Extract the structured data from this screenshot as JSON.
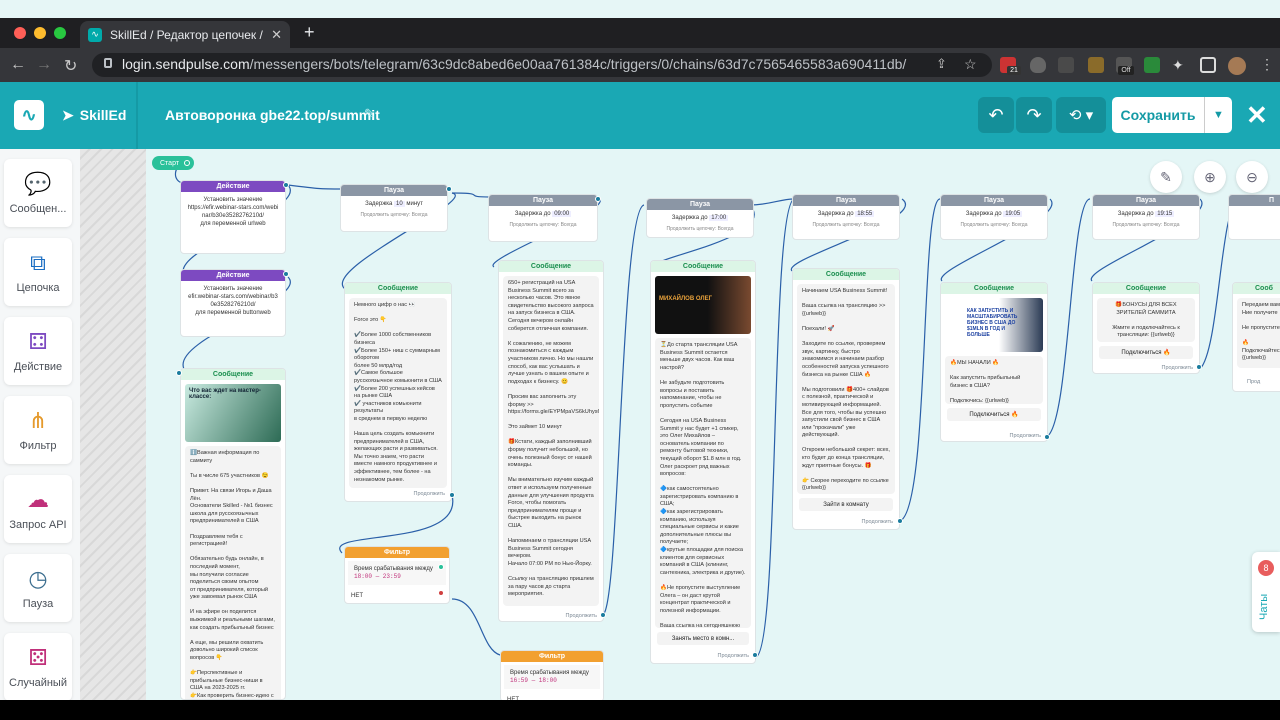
{
  "browser": {
    "tab_title": "SkillEd / Редактор цепочек / Ч",
    "url_host": "login.sendpulse.com",
    "url_path": "/messengers/bots/telegram/63c9dc8abed6e00aa761384c/triggers/0/chains/63d7c7565465583a690411db/",
    "ext_badge": "21",
    "ext_off": "Off"
  },
  "app": {
    "brand": "SkillEd",
    "funnel_title": "Автоворонка gbe22.top/summit",
    "save_label": "Сохранить"
  },
  "sidebar": {
    "items": [
      {
        "label": "Сообщен..."
      },
      {
        "label": "Цепочка"
      },
      {
        "label": "Действие"
      },
      {
        "label": "Фильтр"
      },
      {
        "label": "Запрос API"
      },
      {
        "label": "Пауза"
      },
      {
        "label": "Случайный"
      }
    ]
  },
  "canvas": {
    "start_label": "Старт",
    "action1": {
      "title": "Действие",
      "line1": "Установить значение",
      "line2": "https://efir.webinar-stars.com/webinar/b30e3528276210d/",
      "line3": "для переменной",
      "var": "urlweb"
    },
    "action2": {
      "title": "Действие",
      "line1": "Установить значение",
      "line2": "efir.webinar-stars.com/webinar/b30e3528276210d/",
      "line3": "для переменной",
      "var": "buttonweb"
    },
    "msg1": {
      "title": "Сообщение",
      "img_text": "Что вас ждет на мастер-классе:",
      "text": "ℹ️Важная информация по саммиту\n\nТы в числе 675 участников 😉\n\nПривет. На связи Игорь и Даша Лён.\nОснователи Skilled - №1 бизнес школа для русскоязычных предпринимателей в США\n\nПоздравляем тебя с регистрацией!\n\nОбязательно будь онлайн, в последний момент,\nмы получили согласие поделиться своим опытом\nот предпринимателя, который уже завоевал рынок США\n\nИ на эфире он поделится выжимкой и реальными шагами, как создать прибыльный бизнес\n\nА еще, мы решили охватить довольно широкий список вопросов 👇\n\n👉Перспективные и прибыльные бизнес-ниши в США на 2023-2025 гг.\n👉Как проверить бизнес-идею с минимальными вложениями?"
    },
    "pause1": {
      "title": "Пауза",
      "text": "Задержка",
      "value": "10",
      "unit": "минут",
      "sub": "Продолжить цепочку: Всегда"
    },
    "msg2": {
      "title": "Сообщение",
      "text": "Немного цифр о нас 👀\n\nForce это 👇\n\n✔️Более 1000 собственников бизнеса\n✔️Более 150+ ниш с суммарным оборотом\nболее 50 млрд/год\n✔️Самое большое русскоязычное комьюнити в США\n✔️Более 200 успешных кейсов на рынке США\n✔️ участников комьюнити\nрезультаты\nв среднем в первую неделю\n\nНаша цель создать комьюнити предпринимателей в США, желающих расти и развиваться. Мы точно знаем, что расти вместе намного продуктивнее и эффективнее, тем более - на незнакомом рынке.",
      "cont": "Продолжить"
    },
    "filter1": {
      "title": "Фильтр",
      "label": "Время срабатывания",
      "mode": "между",
      "range": "18:00 — 23:59",
      "no": "НЕТ"
    },
    "pause2": {
      "title": "Пауза",
      "text": "Задержка до",
      "value": "09:00",
      "sub": "Продолжить цепочку: Всегда"
    },
    "msg3": {
      "title": "Сообщение",
      "text": "650+ регистраций на USA Business Summit всего за несколько часов. Это явное свидетельство высокого запроса на запуск бизнеса в США. Сегодня вечером онлайн соберется отличная компания.\n\nК сожалению, не можем познакомиться с каждым участником лично. Но мы нашли способ, как вас услышать и лучше узнать о вашем опыте и подходах к бизнесу. 😊\n\nПросим вас заполнить эту форму >>\nhttps://forms.gle/EYPMpaVS6kUhys6Q8\n\nЭто займет 10 минут\n\n🎁Кстати, каждый заполнивший форму получит небольшой, но очень полезный бонус от нашей команды.\n\nМы внимательно изучим каждый ответ и используем полученные данные для улучшения продукта Force, чтобы помогать предпринимателям проще и быстрее выходить на рынок США.\n\nНапоминаем о трансляции USA Business Summit сегодня вечером.\nНачало 07:00 PM по Нью-Йорку.\n\nСсылку на трансляцию пришлем за пару часов до старта мероприятия.",
      "cont": "Продолжить"
    },
    "filter2": {
      "title": "Фильтр",
      "label": "Время срабатывания",
      "mode": "между",
      "range": "16:59 — 18:00",
      "no": "НЕТ"
    },
    "pause3": {
      "title": "Пауза",
      "text": "Задержка до",
      "value": "17:00",
      "sub": "Продолжить цепочку: Всегда"
    },
    "msg4": {
      "title": "Сообщение",
      "img_text": "МИХАЙЛОВ ОЛЕГ",
      "text": "⏳До старта трансляции USA Business Summit остается меньше двух часов. Как ваш настрой?\n\nНе забудьте подготовить вопросы и поставить напоминание, чтобы не пропустить событие\n\nСегодня на USA Business Summit у нас будет +1 спикер, это Олег Михайлов – основатель компании по ремонту бытовой техники, текущий оборот $1.8 млн в год. Олег раскроет ряд важных вопросов:\n\n🔷как самостоятельно зарегистрировать компанию в США;\n🔷как зарегистрировать компанию, используя специальные сервисы и какие дополнительные плюсы вы получаете;\n🔷крутые площадки для поиска клиентов для сервисных компаний в США (клининг, сантехника, электрика и другие).\n\n🔥Не пропустите выступление Олега – он даст крутой концентрат практической и полезной информации.\n\nВаша ссылка на сегодняшнюю трансляцию >> {{urlweb}}",
      "button": "Занять место в комн...",
      "cont": "Продолжить"
    },
    "pause4": {
      "title": "Пауза",
      "text": "Задержка до",
      "value": "18:55",
      "sub": "Продолжить цепочку: Всегда"
    },
    "msg5": {
      "title": "Сообщение",
      "text": "Начинаем USA Business Summit!\n\nВаша ссылка на трансляцию >> {{urlweb}}\n\nПоехали! 🚀\n\nЗаходите по ссылке, проверяем звук, картинку, быстро знакомимся и начинаем разбор особенностей запуска успешного бизнеса на рынке США 🔥\n\nМы подготовили 🎁400+ слайдов с полезной, практической и мотивирующей информацией. Все для того, чтобы вы успешно запустили свой бизнес в США или \"прокачали\" уже действующий.\n\nОткроем небольшой секрет: всех, кто будет до конца трансляции, ждут приятные бонусы. 🎁\n\n👉 Скорее переходите по ссылке {{urlweb}}",
      "button": "Зайти в комнату",
      "cont": "Продолжить"
    },
    "pause5": {
      "title": "Пауза",
      "text": "Задержка до",
      "value": "19:05",
      "sub": "Продолжить цепочку: Всегда"
    },
    "msg6": {
      "title": "Сообщение",
      "img_text": "КАК ЗАПУСТИТЬ И МАСШТАБИРОВАТЬ БИЗНЕС В США ДО $1MLN В ГОД И БОЛЬШЕ",
      "text": "🔥МЫ НАЧАЛИ 🔥\n\nКак запустить прибыльный бизнес в США?\n\nПодключись: {{urlweb}}",
      "button": "Подключиться 🔥",
      "cont": "Продолжить"
    },
    "pause6": {
      "title": "Пауза",
      "text": "Задержка до",
      "value": "19:15",
      "sub": "Продолжить цепочку: Всегда"
    },
    "msg7": {
      "title": "Сообщение",
      "text": "🎁БОНУСЫ ДЛЯ ВСЕХ ЗРИТЕЛЕЙ САММИТА\n\nЖмите и подключайтесь к трансляции: {{urlweb}}",
      "button": "Подключиться 🔥",
      "cont": "Продолжить"
    },
    "pause7": {
      "title": "П"
    },
    "msg8": {
      "title": "Сооб",
      "text": "Передаем вам\nНие получите\n\nНе пропустите\n\n🔥Подключайтесь\n{{urlweb}}",
      "cont": "Прод"
    }
  },
  "chats": {
    "label": "Чаты",
    "count": "8"
  }
}
